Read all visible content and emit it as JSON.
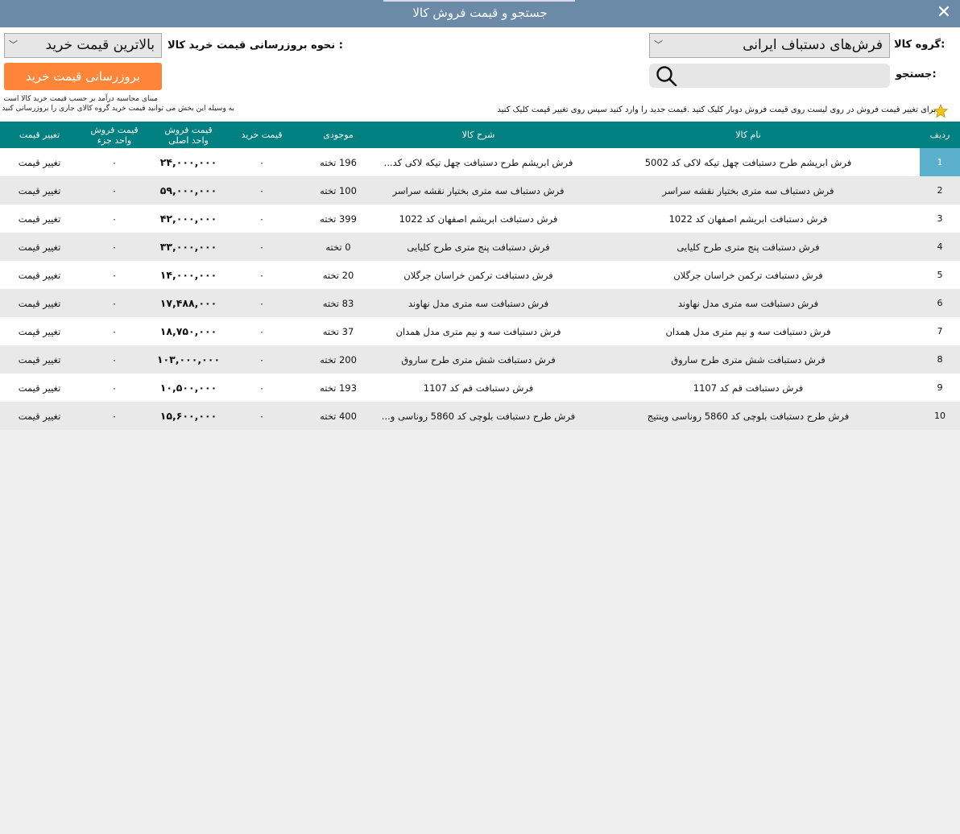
{
  "window": {
    "title": "جستجو و قیمت فروش کالا",
    "close_icon": "close-icon"
  },
  "filters": {
    "group_label": "گروه کالا:",
    "group_value": "فرش‌های دستباف ایرانی",
    "search_label": "جستجو:",
    "search_value": "",
    "search_icon": "search-icon",
    "update_method_label": "نحوه بروزرسانی قیمت خرید کالا :",
    "update_method_value": "بالاترین قیمت خرید",
    "update_button": "بروزرسانی قیمت خرید",
    "note_line1": "مبنای محاسبه درآمد بر حسب قیمت خرید کالا است",
    "note_line2": "به وسیله این بخش می توانید قیمت خرید گروه کالای جاری را بروزرسانی کنید",
    "hint": "برای تغییر قیمت فروش در روی لیست روی قیمت فروش دوبار کلیک کنید .قیمت جدید را وارد کنید سپس روی تغییر قیمت کلیک کنید",
    "hint_icon": "star-icon",
    "accent_color": "#ff8538",
    "header_color": "#008080"
  },
  "table": {
    "headers": {
      "row": "ردیف",
      "name": "نام کالا",
      "desc": "شرح کالا",
      "stock": "موجودی",
      "buy": "قیمت خرید",
      "sale_main_1": "قیمت فروش",
      "sale_main_2": "واحد اصلی",
      "sale_part_1": "قیمت فروش",
      "sale_part_2": "واحد جزء",
      "change": "تغییر قیمت"
    },
    "rows": [
      {
        "no": "1",
        "name": "فرش ابریشم طرح دستبافت چهل تیکه لاکی کد 5002",
        "desc": "فرش ابریشم طرح دستبافت چهل تیکه لاکی کد...",
        "stock": "196 تخته",
        "buy": "۰",
        "sale_main": "۲۴,۰۰۰,۰۰۰",
        "sale_part": "۰",
        "change": "تغییر قیمت"
      },
      {
        "no": "2",
        "name": "فرش دستباف سه متری بختیار نقشه سراسر",
        "desc": "فرش دستباف سه متری بختیار نقشه سراسر",
        "stock": "100 تخته",
        "buy": "۰",
        "sale_main": "۵۹,۰۰۰,۰۰۰",
        "sale_part": "۰",
        "change": "تغییر قیمت"
      },
      {
        "no": "3",
        "name": "فرش دستبافت ابریشم اصفهان کد 1022",
        "desc": "فرش دستبافت ابریشم اصفهان کد 1022",
        "stock": "399 تخته",
        "buy": "۰",
        "sale_main": "۴۲,۰۰۰,۰۰۰",
        "sale_part": "۰",
        "change": "تغییر قیمت"
      },
      {
        "no": "4",
        "name": "فرش دستبافت پنج متری طرح کلیایی",
        "desc": "فرش دستبافت پنج متری طرح کلیایی",
        "stock": "0 تخته",
        "buy": "۰",
        "sale_main": "۳۳,۰۰۰,۰۰۰",
        "sale_part": "۰",
        "change": "تغییر قیمت"
      },
      {
        "no": "5",
        "name": "فرش دستبافت ترکمن خراسان جرگلان",
        "desc": "فرش دستبافت ترکمن خراسان جرگلان",
        "stock": "20 تخته",
        "buy": "۰",
        "sale_main": "۱۴,۰۰۰,۰۰۰",
        "sale_part": "۰",
        "change": "تغییر قیمت"
      },
      {
        "no": "6",
        "name": "فرش دستبافت سه متری مدل نهاوند",
        "desc": "فرش دستبافت سه متری مدل نهاوند",
        "stock": "83 تخته",
        "buy": "۰",
        "sale_main": "۱۷,۴۸۸,۰۰۰",
        "sale_part": "۰",
        "change": "تغییر قیمت"
      },
      {
        "no": "7",
        "name": "فرش دستبافت سه و نیم متری مدل همدان",
        "desc": "فرش دستبافت سه و نیم متری مدل همدان",
        "stock": "37 تخته",
        "buy": "۰",
        "sale_main": "۱۸,۷۵۰,۰۰۰",
        "sale_part": "۰",
        "change": "تغییر قیمت"
      },
      {
        "no": "8",
        "name": "فرش دستبافت شش متری طرح ساروق",
        "desc": "فرش دستبافت شش متری طرح ساروق",
        "stock": "200 تخته",
        "buy": "۰",
        "sale_main": "۱۰۳,۰۰۰,۰۰۰",
        "sale_part": "۰",
        "change": "تغییر قیمت"
      },
      {
        "no": "9",
        "name": "فرش دستبافت قم کد 1107",
        "desc": "فرش دستبافت قم کد 1107",
        "stock": "193 تخته",
        "buy": "۰",
        "sale_main": "۱۰,۵۰۰,۰۰۰",
        "sale_part": "۰",
        "change": "تغییر قیمت"
      },
      {
        "no": "10",
        "name": "فرش طرح دستبافت بلوچی کد 5860 روناسی وینتیج",
        "desc": "فرش طرح دستبافت بلوچی کد 5860 روناسی و...",
        "stock": "400 تخته",
        "buy": "۰",
        "sale_main": "۱۵,۶۰۰,۰۰۰",
        "sale_part": "۰",
        "change": "تغییر قیمت"
      }
    ]
  }
}
